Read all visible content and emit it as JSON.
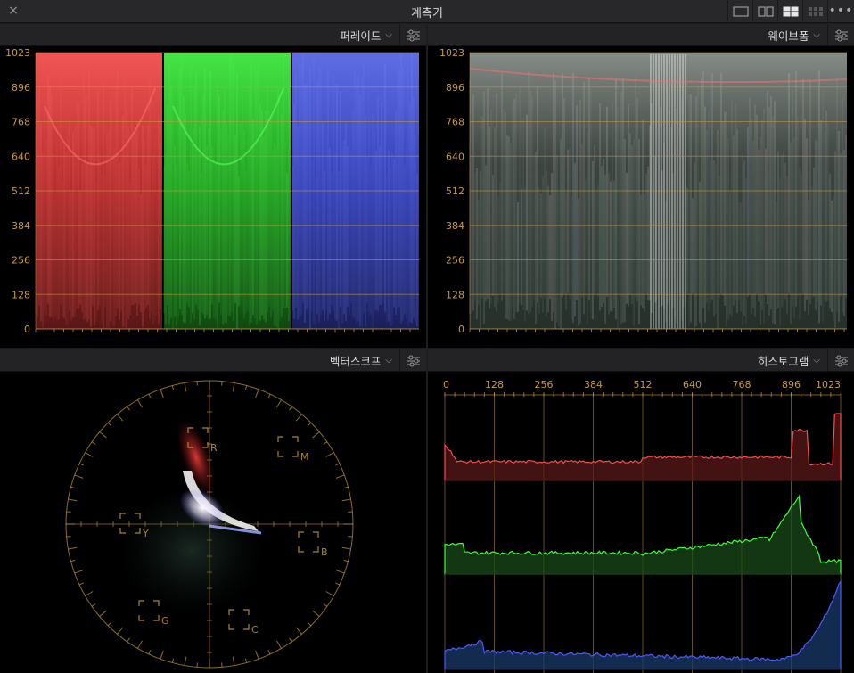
{
  "window": {
    "title": "계측기",
    "close_glyph": "×",
    "more_glyph": "•••"
  },
  "layout_buttons": [
    {
      "name": "single",
      "active": false
    },
    {
      "name": "dual",
      "active": false
    },
    {
      "name": "quad-mixed",
      "active": true
    },
    {
      "name": "grid",
      "active": false
    }
  ],
  "panels": {
    "parade": {
      "label": "퍼레이드",
      "chevron": "⌵"
    },
    "waveform": {
      "label": "웨이브폼",
      "chevron": "⌵"
    },
    "vectorscope": {
      "label": "벡터스코프",
      "chevron": "⌵"
    },
    "histogram": {
      "label": "히스토그램",
      "chevron": "⌵"
    }
  },
  "waveform_scale": [
    "1023",
    "896",
    "768",
    "640",
    "512",
    "384",
    "256",
    "128",
    "0"
  ],
  "histogram_scale": [
    "0",
    "128",
    "256",
    "384",
    "512",
    "640",
    "768",
    "896",
    "1023"
  ],
  "vectorscope_targets": [
    "R",
    "M",
    "Y",
    "B",
    "G",
    "C"
  ],
  "colors": {
    "accent": "#c89a3c",
    "red": "#ff4a4a",
    "green": "#3cff3c",
    "blue": "#4a5aff",
    "hist_red_fill": "#5a1a1a",
    "hist_green_fill": "#1a4a1a",
    "hist_blue_fill": "#1a3a6a"
  }
}
